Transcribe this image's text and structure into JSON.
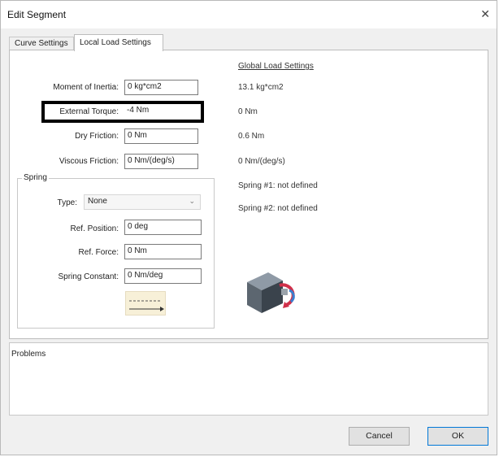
{
  "window": {
    "title": "Edit Segment",
    "close_glyph": "✕"
  },
  "tabs": [
    {
      "label": "Curve Settings",
      "active": false
    },
    {
      "label": "Local Load Settings",
      "active": true
    }
  ],
  "local": {
    "moment_label": "Moment of Inertia:",
    "moment_value": "0 kg*cm2",
    "torque_label": "External Torque:",
    "torque_value": "-4 Nm",
    "dry_label": "Dry Friction:",
    "dry_value": "0 Nm",
    "viscous_label": "Viscous Friction:",
    "viscous_value": "0 Nm/(deg/s)"
  },
  "global": {
    "heading": "Global Load Settings",
    "moment": "13.1 kg*cm2",
    "torque": "0 Nm",
    "dry": "0.6 Nm",
    "viscous": "0 Nm/(deg/s)",
    "spring1": "Spring #1: not defined",
    "spring2": "Spring #2: not defined"
  },
  "spring": {
    "group_title": "Spring",
    "type_label": "Type:",
    "type_value": "None",
    "ref_pos_label": "Ref. Position:",
    "ref_pos_value": "0 deg",
    "ref_force_label": "Ref. Force:",
    "ref_force_value": "0 Nm",
    "constant_label": "Spring Constant:",
    "constant_value": "0 Nm/deg"
  },
  "problems": {
    "label": "Problems"
  },
  "buttons": {
    "cancel": "Cancel",
    "ok": "OK"
  },
  "colors": {
    "highlight": "#000000",
    "accent": "#0078d7",
    "motor_arrow": "#d0304a",
    "motor_arrow2": "#3a7fd0"
  }
}
